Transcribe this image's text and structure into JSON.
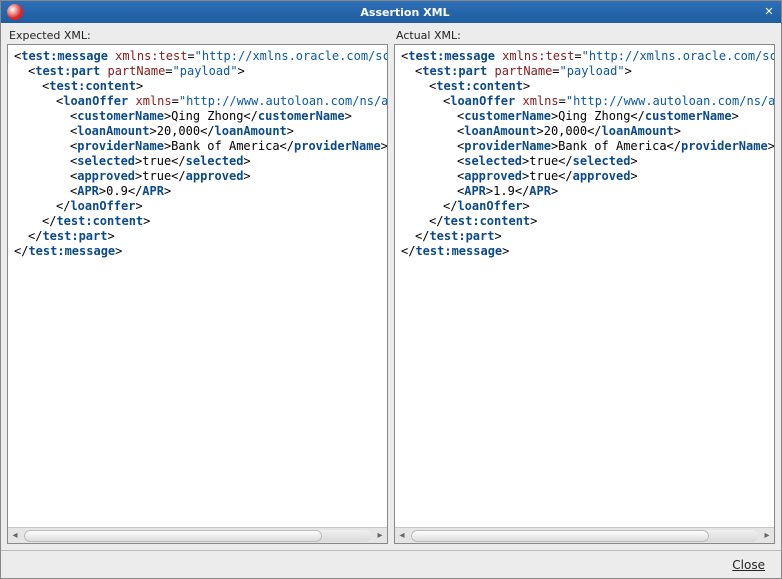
{
  "window": {
    "title": "Assertion XML",
    "close_label": "Close"
  },
  "panels": {
    "expected": {
      "label": "Expected XML:"
    },
    "actual": {
      "label": "Actual XML:"
    }
  },
  "xml": {
    "expected": {
      "message_tag": "test:message",
      "xmlns_attr": "xmlns:test",
      "xmlns_val": "http://xmlns.oracle.com/sca/",
      "part_tag": "test:part",
      "partName_attr": "partName",
      "partName_val": "payload",
      "content_tag": "test:content",
      "loanOffer_tag": "loanOffer",
      "loanOffer_xmlns_attr": "xmlns",
      "loanOffer_xmlns_val": "http://www.autoloan.com/ns/aut",
      "customerName_tag": "customerName",
      "customerName_val": "Qing Zhong",
      "loanAmount_tag": "loanAmount",
      "loanAmount_val": "20,000",
      "providerName_tag": "providerName",
      "providerName_val": "Bank of America",
      "selected_tag": "selected",
      "selected_val": "true",
      "approved_tag": "approved",
      "approved_val": "true",
      "apr_tag": "APR",
      "apr_val": "0.9"
    },
    "actual": {
      "message_tag": "test:message",
      "xmlns_attr": "xmlns:test",
      "xmlns_val": "http://xmlns.oracle.com/sca/",
      "part_tag": "test:part",
      "partName_attr": "partName",
      "partName_val": "payload",
      "content_tag": "test:content",
      "loanOffer_tag": "loanOffer",
      "loanOffer_xmlns_attr": "xmlns",
      "loanOffer_xmlns_val": "http://www.autoloan.com/ns/aut",
      "customerName_tag": "customerName",
      "customerName_val": "Qing Zhong",
      "loanAmount_tag": "loanAmount",
      "loanAmount_val": "20,000",
      "providerName_tag": "providerName",
      "providerName_val": "Bank of America",
      "selected_tag": "selected",
      "selected_val": "true",
      "approved_tag": "approved",
      "approved_val": "true",
      "apr_tag": "APR",
      "apr_val": "1.9"
    }
  }
}
